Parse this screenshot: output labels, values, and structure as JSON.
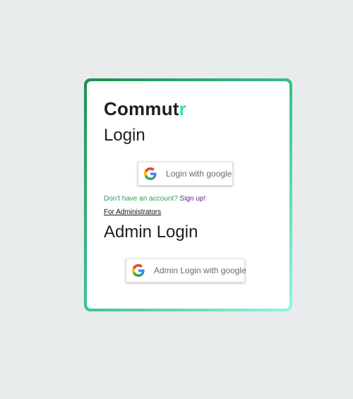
{
  "brand": {
    "name_main": "Commut",
    "name_accent": "r",
    "accent_color": "#2ee6a3"
  },
  "login": {
    "heading": "Login",
    "google_button_label": "Login with google",
    "google_icon": "google-g-icon"
  },
  "signup": {
    "prompt": "Don't have an account?",
    "link_label": "Sign up!"
  },
  "admin": {
    "link_label": "For Administrators",
    "heading": "Admin Login",
    "google_button_label": "Admin Login with google",
    "google_icon": "google-g-icon"
  },
  "colors": {
    "background": "#e8ecec",
    "frame_gradient_start": "#1f8f52",
    "frame_gradient_end": "#8ef7e3",
    "signup_prompt": "#2e9d57",
    "signup_link": "#5b1f8f"
  }
}
